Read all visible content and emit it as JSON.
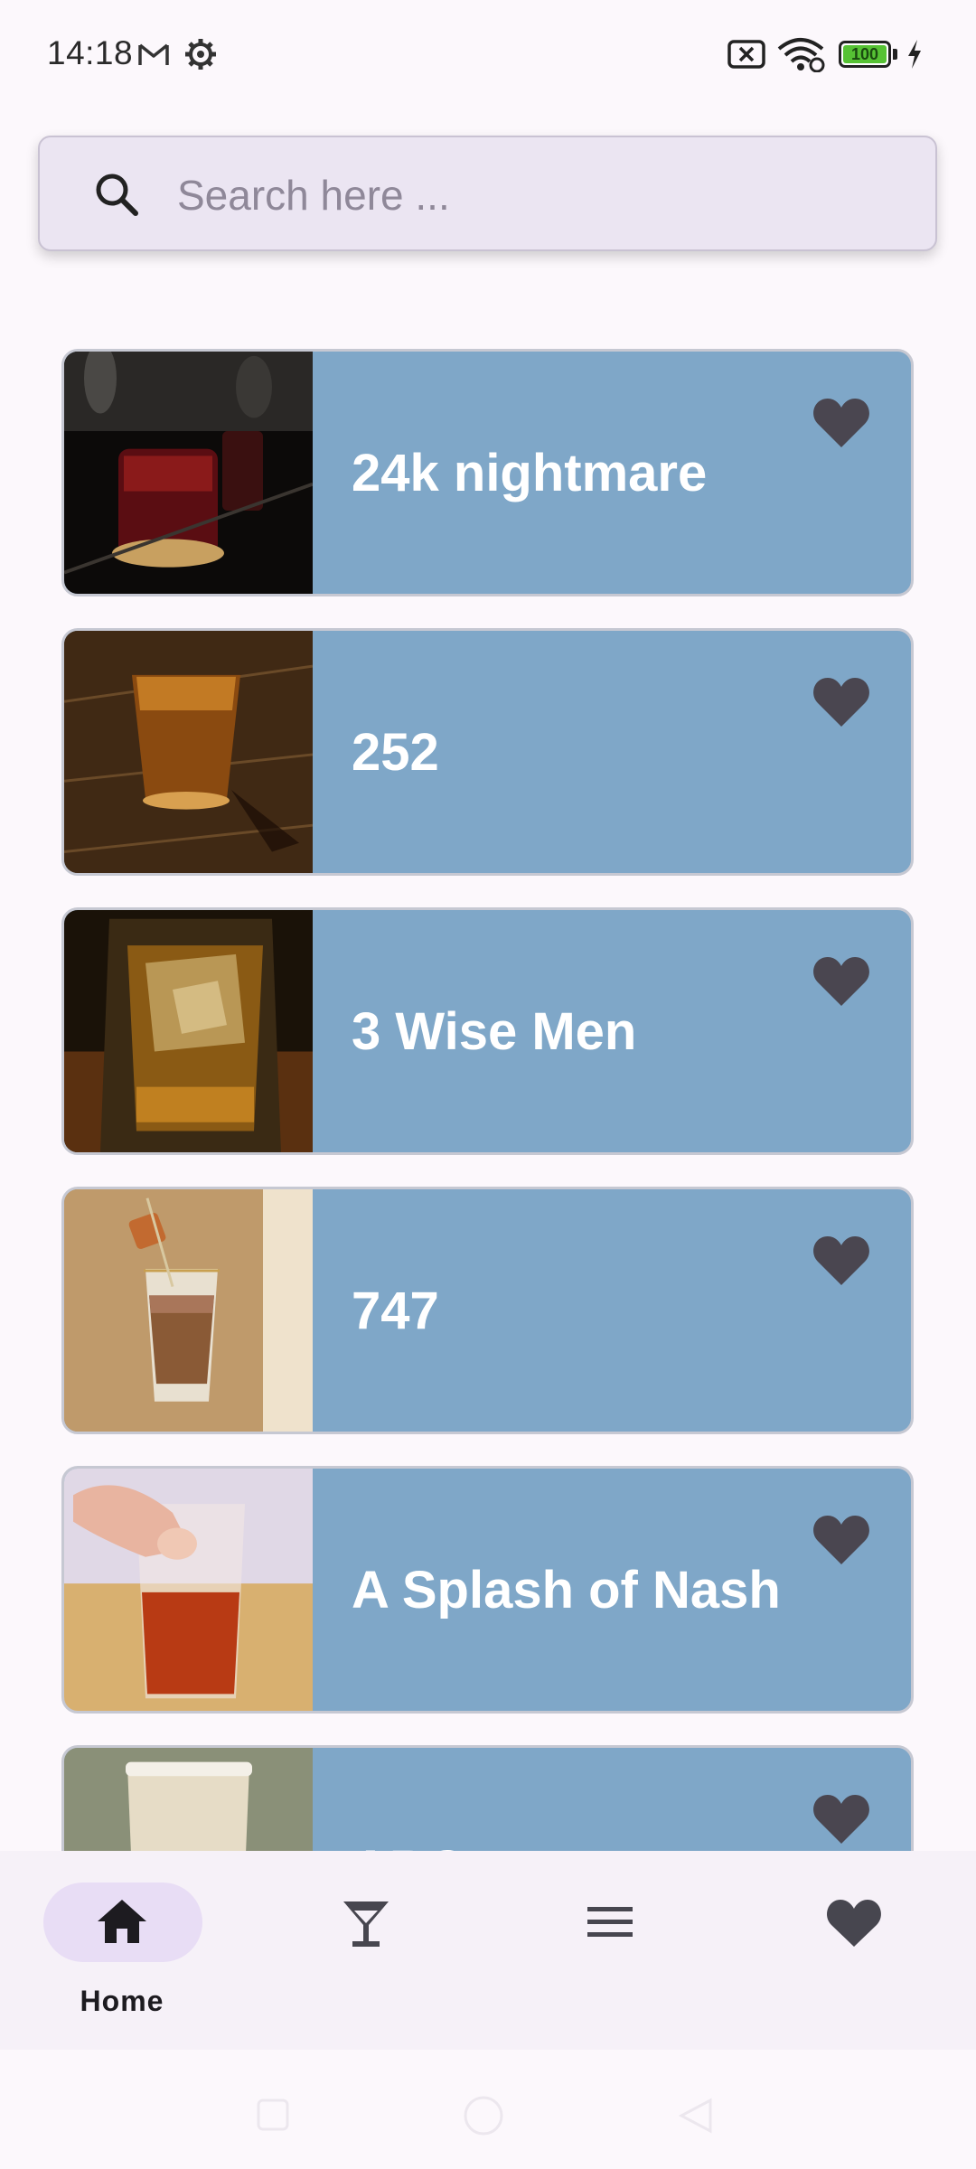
{
  "status_bar": {
    "time": "14:18",
    "battery_level": "100",
    "icons": [
      "gmail-icon",
      "settings-icon",
      "no-sim-icon",
      "wifi-icon",
      "battery-icon",
      "charging-icon"
    ]
  },
  "search": {
    "placeholder": "Search here ...",
    "icon": "search-icon"
  },
  "drinks": [
    {
      "name": "24k nightmare",
      "favorite_icon": "heart-icon"
    },
    {
      "name": "252",
      "favorite_icon": "heart-icon"
    },
    {
      "name": "3 Wise Men",
      "favorite_icon": "heart-icon"
    },
    {
      "name": "747",
      "favorite_icon": "heart-icon"
    },
    {
      "name": "A Splash of Nash",
      "favorite_icon": "heart-icon"
    },
    {
      "name": "ABC",
      "favorite_icon": "heart-icon"
    }
  ],
  "bottom_nav": {
    "items": [
      {
        "label": "Home",
        "icon": "home-icon",
        "selected": true
      },
      {
        "label": "",
        "icon": "cocktail-icon",
        "selected": false
      },
      {
        "label": "",
        "icon": "menu-icon",
        "selected": false
      },
      {
        "label": "",
        "icon": "heart-icon",
        "selected": false
      }
    ]
  },
  "colors": {
    "card_background": "#7fa7c8",
    "page_background": "#fcf8fc",
    "search_background": "#ebe5f2",
    "nav_selected_pill": "#e8ddf5",
    "heart": "#4a4650"
  }
}
